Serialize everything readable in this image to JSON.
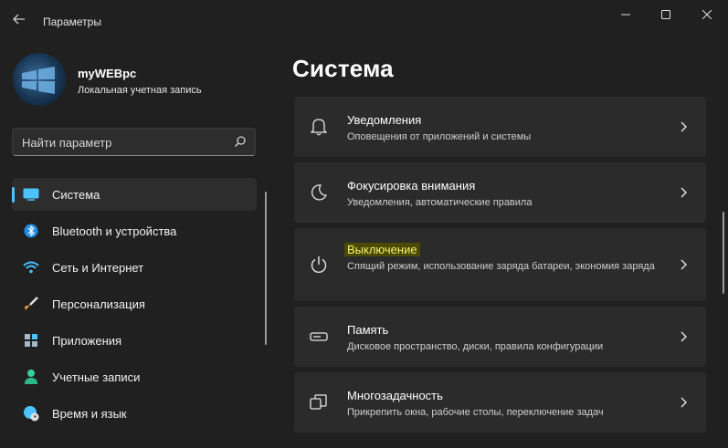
{
  "window": {
    "title": "Параметры",
    "back_icon": "back-arrow-icon",
    "min_icon": "minimize-icon",
    "max_icon": "maximize-icon",
    "close_icon": "close-icon"
  },
  "profile": {
    "name": "myWEBpc",
    "account_type": "Локальная учетная запись",
    "avatar_icon": "windows-logo-icon"
  },
  "search": {
    "placeholder": "Найти параметр",
    "icon": "search-icon"
  },
  "sidebar": {
    "accent_color": "#4cc2ff",
    "items": [
      {
        "label": "Система",
        "icon": "display-icon",
        "active": true
      },
      {
        "label": "Bluetooth и устройства",
        "icon": "bluetooth-icon",
        "active": false
      },
      {
        "label": "Сеть и Интернет",
        "icon": "wifi-icon",
        "active": false
      },
      {
        "label": "Персонализация",
        "icon": "brush-icon",
        "active": false
      },
      {
        "label": "Приложения",
        "icon": "apps-icon",
        "active": false
      },
      {
        "label": "Учетные записи",
        "icon": "person-icon",
        "active": false
      },
      {
        "label": "Время и язык",
        "icon": "globe-clock-icon",
        "active": false
      }
    ]
  },
  "main": {
    "title": "Система",
    "cards": [
      {
        "title": "Уведомления",
        "description": "Оповещения от приложений и системы",
        "icon": "bell-icon",
        "highlighted": false
      },
      {
        "title": "Фокусировка внимания",
        "description": "Уведомления, автоматические правила",
        "icon": "moon-icon",
        "highlighted": false
      },
      {
        "title": "Выключение",
        "description": "Спящий режим, использование заряда батареи, экономия заряда",
        "icon": "power-icon",
        "highlighted": true
      },
      {
        "title": "Память",
        "description": "Дисковое пространство, диски, правила конфигурации",
        "icon": "storage-icon",
        "highlighted": false
      },
      {
        "title": "Многозадачность",
        "description": "Прикрепить окна, рабочие столы, переключение задач",
        "icon": "multitasking-icon",
        "highlighted": false
      }
    ]
  }
}
